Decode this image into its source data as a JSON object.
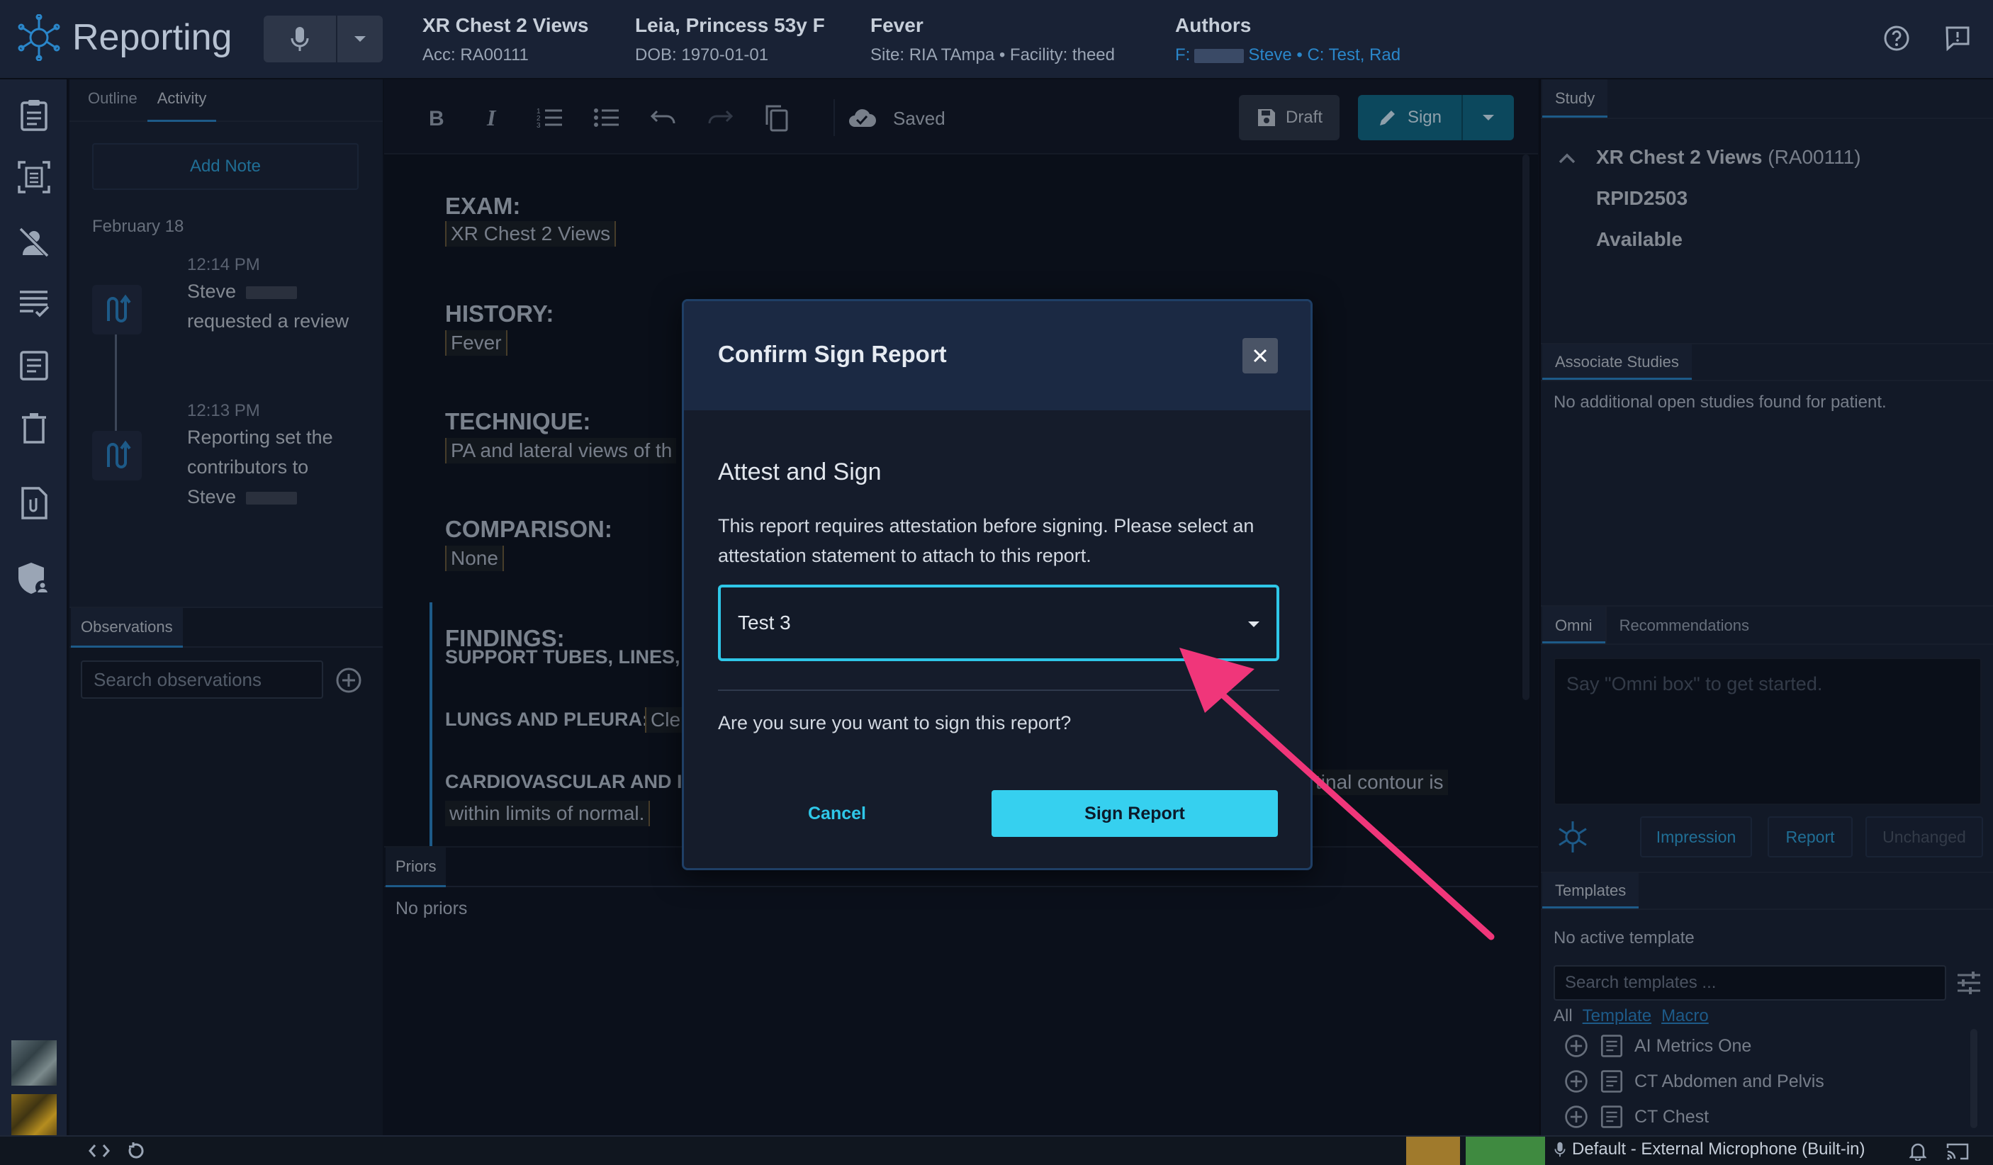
{
  "header": {
    "app_title": "Reporting",
    "study": {
      "title": "XR Chest 2 Views",
      "sub": "Acc: RA00111"
    },
    "patient": {
      "title": "Leia, Princess 53y F",
      "sub": "DOB: 1970-01-01"
    },
    "reason": {
      "title": "Fever",
      "sub": "Site: RIA TAmpa • Facility: theed"
    },
    "authors": {
      "title": "Authors",
      "prefix": "F:",
      "first": "Steve • C: Test, Rad"
    }
  },
  "activity": {
    "tabs": [
      "Outline",
      "Activity"
    ],
    "add_note": "Add Note",
    "date": "February 18",
    "items": [
      {
        "time": "12:14 PM",
        "text_a": "Steve",
        "text_b": "requested a review"
      },
      {
        "time": "12:13 PM",
        "text_a": "Reporting set the contributors to",
        "text_b": "Steve"
      }
    ]
  },
  "observations": {
    "tab": "Observations",
    "placeholder": "Search observations"
  },
  "toolbar": {
    "saved": "Saved",
    "draft": "Draft",
    "sign": "Sign"
  },
  "report": {
    "exam_h": "EXAM:",
    "exam_v": "XR Chest 2 Views",
    "history_h": "HISTORY:",
    "history_v": "Fever",
    "technique_h": "TECHNIQUE:",
    "technique_v": "PA and lateral views of th",
    "comparison_h": "COMPARISON:",
    "comparison_v": "None",
    "findings_h": "FINDINGS:",
    "support": "SUPPORT TUBES, LINES,",
    "lungs": "LUNGS AND PLEURA:",
    "lungs_v": "Cle",
    "cardio": "CARDIOVASCULAR AND I",
    "cardio_tail": "tinal contour is",
    "cardio_line2": "within limits of normal."
  },
  "priors": {
    "tab": "Priors",
    "empty": "No priors"
  },
  "study_panel": {
    "tab": "Study",
    "title": "XR Chest 2 Views",
    "acc": "(RA00111)",
    "rpid": "RPID2503",
    "status": "Available"
  },
  "associate": {
    "tab": "Associate Studies",
    "empty": "No additional open studies found for patient."
  },
  "omni": {
    "tabs": [
      "Omni",
      "Recommendations"
    ],
    "placeholder": "Say \"Omni box\" to get started.",
    "buttons": [
      "Impression",
      "Report",
      "Unchanged"
    ]
  },
  "templates": {
    "tab": "Templates",
    "empty": "No active template",
    "placeholder": "Search templates ...",
    "filters": [
      "All",
      "Template",
      "Macro"
    ],
    "items": [
      "AI Metrics One",
      "CT Abdomen and Pelvis",
      "CT Chest"
    ]
  },
  "statusbar": {
    "mic": "Default - External Microphone (Built-in)"
  },
  "modal": {
    "title": "Confirm Sign Report",
    "subtitle": "Attest and Sign",
    "description": "This report requires attestation before signing. Please select an attestation statement to attach to this report.",
    "selected": "Test 3",
    "question": "Are you sure you want to sign this report?",
    "cancel": "Cancel",
    "confirm": "Sign Report"
  },
  "colors": {
    "accent": "#36d0ef",
    "arrow": "#f0367a",
    "link": "#2a86c9"
  }
}
